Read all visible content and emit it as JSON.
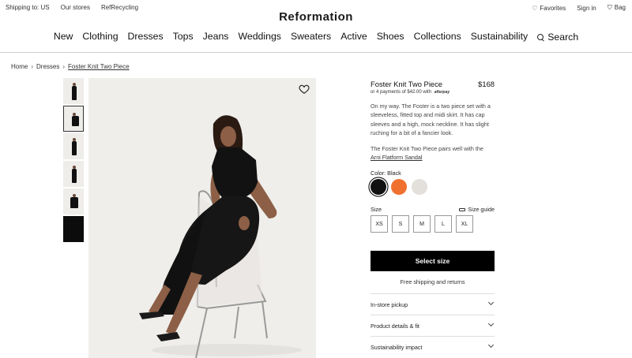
{
  "utility": {
    "left": [
      "Shipping to: US",
      "Our stores",
      "RefRecycling"
    ],
    "favorites": "Favorites",
    "signin": "Sign in",
    "bag": "Bag"
  },
  "brand": "Reformation",
  "nav": [
    "New",
    "Clothing",
    "Dresses",
    "Tops",
    "Jeans",
    "Weddings",
    "Sweaters",
    "Active",
    "Shoes",
    "Collections",
    "Sustainability"
  ],
  "search_label": "Search",
  "breadcrumb": [
    "Home",
    "Dresses",
    "Foster Knit Two Piece"
  ],
  "product": {
    "title": "Foster Knit Two Piece",
    "price": "$168",
    "payments": "or 4 payments of $42.00 with",
    "payments_logo": "afterpay",
    "description": "On my way. The Foster is a two piece set with a sleeveless, fitted top and midi skirt. It has cap sleeves and a high, mock neckline. It has slight ruching for a bit of a fancier look.",
    "pairs_text": "The Foster Knit Two Piece pairs well with the",
    "pairs_link": "Arni Flatform Sandal",
    "color_label": "Color: Black",
    "colors": [
      {
        "name": "black",
        "hex": "#111111",
        "selected": true
      },
      {
        "name": "orange",
        "hex": "#f07030",
        "selected": false
      },
      {
        "name": "cream",
        "hex": "#e3e0db",
        "selected": false
      }
    ],
    "size_label": "Size",
    "size_guide": "Size guide",
    "sizes": [
      "XS",
      "S",
      "M",
      "L",
      "XL"
    ],
    "cta": "Select size",
    "shipping": "Free shipping and returns",
    "accordions": [
      "In-store pickup",
      "Product details & fit",
      "Sustainability impact"
    ]
  },
  "colors": {
    "image_bg": "#efeeeb",
    "accent": "#000000"
  }
}
